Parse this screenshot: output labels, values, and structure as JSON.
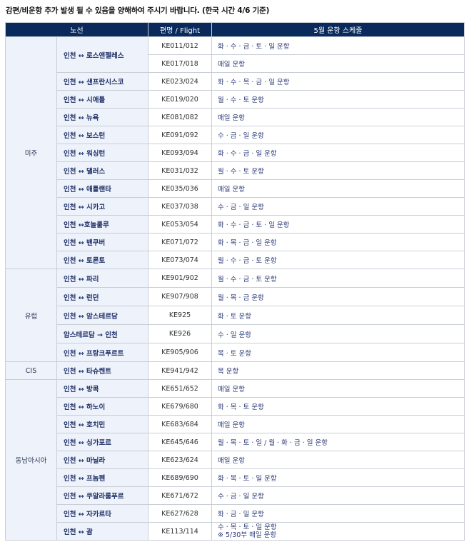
{
  "notice": "감편/비운항 추가 발생 될 수 있음을 양해하여 주시기 바랍니다. (한국 시간 4/6 기준)",
  "table": {
    "headers": {
      "route": "노선",
      "flight": "편명 / Flight",
      "schedule": "5월 운항 스케줄"
    },
    "regions": {
      "americas": "미주",
      "europe": "유럽",
      "cis": "CIS",
      "southeast_asia": "동남아시아"
    },
    "rows": [
      {
        "route": "인천 ↔ 로스앤젤레스",
        "flight": "KE011/012",
        "schedule": "화 · 수 · 금 · 토 · 일  운항"
      },
      {
        "route": "",
        "flight": "KE017/018",
        "schedule": "매일 운항"
      },
      {
        "route": "인천 ↔ 샌프란시스코",
        "flight": "KE023/024",
        "schedule": "화 · 수 · 목 · 금 · 일  운항"
      },
      {
        "route": "인천 ↔ 시애틀",
        "flight": "KE019/020",
        "schedule": "월 · 수 · 토  운항"
      },
      {
        "route": "인천 ↔ 뉴욕",
        "flight": "KE081/082",
        "schedule": "매일 운항"
      },
      {
        "route": "인천 ↔ 보스턴",
        "flight": "KE091/092",
        "schedule": "수 · 금 · 일  운항"
      },
      {
        "route": "인천 ↔ 워싱턴",
        "flight": "KE093/094",
        "schedule": "화 · 수 · 금 · 일  운항"
      },
      {
        "route": "인천 ↔ 댈러스",
        "flight": "KE031/032",
        "schedule": "월 · 수 · 토  운항"
      },
      {
        "route": "인천 ↔ 애틀랜타",
        "flight": "KE035/036",
        "schedule": "매일 운항"
      },
      {
        "route": "인천 ↔ 시카고",
        "flight": "KE037/038",
        "schedule": "수 · 금 · 일  운항"
      },
      {
        "route": "인천 ↔호놀룰루",
        "flight": "KE053/054",
        "schedule": "화 · 수 · 금 · 토 · 일  운항"
      },
      {
        "route": "인천 ↔ 밴쿠버",
        "flight": "KE071/072",
        "schedule": "화 · 목 · 금 · 일  운항"
      },
      {
        "route": "인천 ↔ 토론토",
        "flight": "KE073/074",
        "schedule": "월 · 수 · 금 · 토  운항"
      },
      {
        "route": "인천 ↔ 파리",
        "flight": "KE901/902",
        "schedule": "월 · 수 · 금 · 토  운항"
      },
      {
        "route": "인천 ↔ 런던",
        "flight": "KE907/908",
        "schedule": "월 · 목 · 금  운항"
      },
      {
        "route": "인천 ↔ 암스테르담",
        "flight": "KE925",
        "schedule": "화 · 토  운항"
      },
      {
        "route": "암스테르담 → 인천",
        "flight": "KE926",
        "schedule": "수 · 일  운항"
      },
      {
        "route": "인천  ↔ 프랑크푸르트",
        "flight": "KE905/906",
        "schedule": "목 · 토  운항"
      },
      {
        "route": "인천 ↔ 타슈켄트",
        "flight": "KE941/942",
        "schedule": "목  운항"
      },
      {
        "route": "인천 ↔ 방콕",
        "flight": "KE651/652",
        "schedule": "매일 운항"
      },
      {
        "route": "인천 ↔ 하노이",
        "flight": "KE679/680",
        "schedule": "화 · 목 · 토  운항"
      },
      {
        "route": "인천 ↔ 호치민",
        "flight": "KE683/684",
        "schedule": "매일 운항"
      },
      {
        "route": "인천 ↔ 싱가포르",
        "flight": "KE645/646",
        "schedule": "월 · 목 · 토 · 일 / 월 · 화 · 금 · 일  운항"
      },
      {
        "route": "인천 ↔ 마닐라",
        "flight": "KE623/624",
        "schedule": "매일 운항"
      },
      {
        "route": "인천 ↔ 프놈펜",
        "flight": "KE689/690",
        "schedule": "화 · 목 · 토 · 일  운항"
      },
      {
        "route": "인천 ↔ 쿠알라룸푸르",
        "flight": "KE671/672",
        "schedule": "수 · 금 · 일  운항"
      },
      {
        "route": "인천 ↔ 자카르타",
        "flight": "KE627/628",
        "schedule": "화 · 금 · 일  운항"
      },
      {
        "route": "인천 ↔ 괌",
        "flight": "KE113/114",
        "schedule": "수 · 목 · 토 · 일  운항",
        "note": "※ 5/30부 매일 운항"
      }
    ]
  }
}
